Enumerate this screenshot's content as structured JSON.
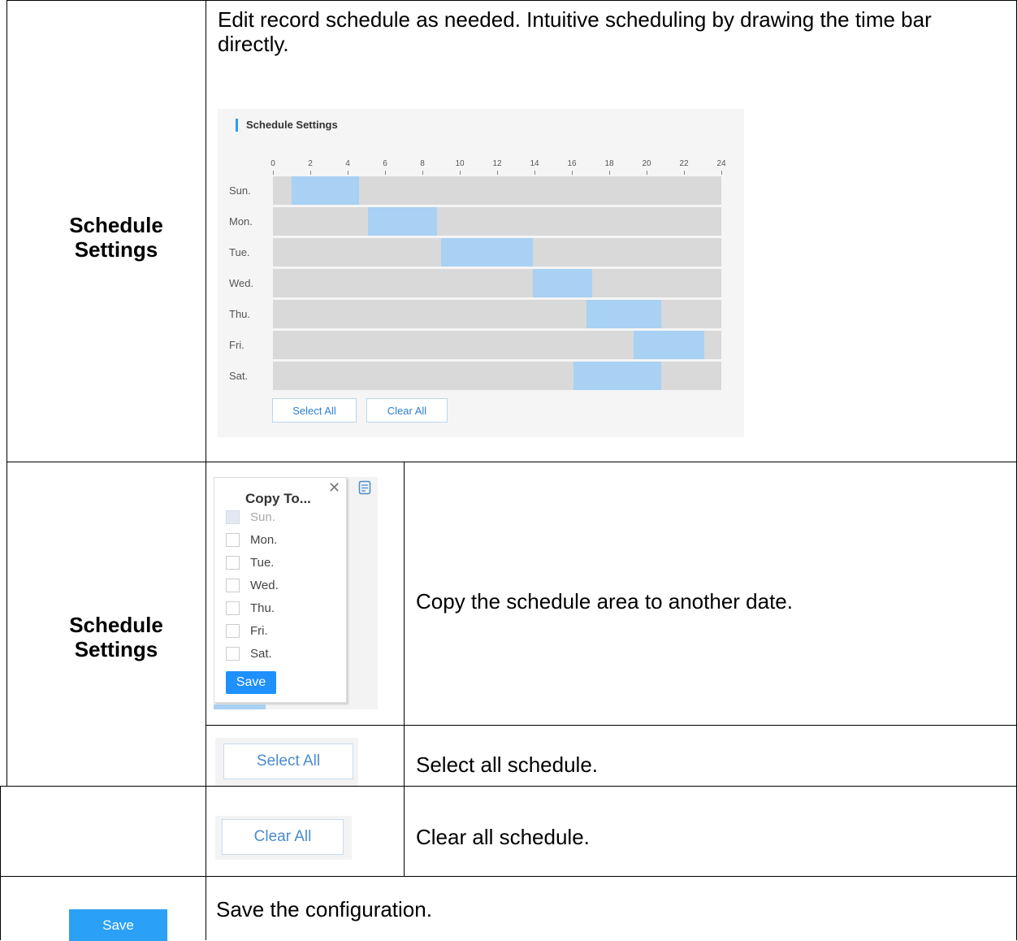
{
  "rows": {
    "r1": {
      "label": "Schedule\nSettings",
      "description": "Edit record schedule as needed. Intuitive scheduling by drawing the time bar directly."
    },
    "r2": {
      "label": "Schedule\nSettings",
      "description": "Copy the schedule area to another date."
    },
    "r3": {
      "description": "Select all schedule."
    },
    "r4": {
      "description": "Clear all schedule."
    },
    "r5": {
      "description": "Save the configuration."
    }
  },
  "schedule_panel": {
    "title": "Schedule Settings",
    "hour_ticks": [
      "0",
      "2",
      "4",
      "6",
      "8",
      "10",
      "12",
      "14",
      "16",
      "18",
      "20",
      "22",
      "24"
    ],
    "days": [
      {
        "label": "Sun.",
        "start": 1,
        "end": 4.6
      },
      {
        "label": "Mon.",
        "start": 5.1,
        "end": 8.8
      },
      {
        "label": "Tue.",
        "start": 9,
        "end": 13.9
      },
      {
        "label": "Wed.",
        "start": 13.9,
        "end": 17.1
      },
      {
        "label": "Thu.",
        "start": 16.8,
        "end": 20.8
      },
      {
        "label": "Fri.",
        "start": 19.3,
        "end": 23.1
      },
      {
        "label": "Sat.",
        "start": 16.1,
        "end": 20.8
      }
    ],
    "select_all": "Select All",
    "clear_all": "Clear All",
    "selection_color": "#a8d1f3"
  },
  "copy_popup": {
    "title": "Copy To...",
    "close_icon": "close-icon",
    "days": [
      {
        "label": "Sun.",
        "disabled": true
      },
      {
        "label": "Mon.",
        "disabled": false
      },
      {
        "label": "Tue.",
        "disabled": false
      },
      {
        "label": "Wed.",
        "disabled": false
      },
      {
        "label": "Thu.",
        "disabled": false
      },
      {
        "label": "Fri.",
        "disabled": false
      },
      {
        "label": "Sat.",
        "disabled": false
      }
    ],
    "save": "Save"
  },
  "buttons": {
    "select_all": "Select All",
    "clear_all": "Clear All",
    "save": "Save"
  },
  "colors": {
    "accent": "#1e90ff",
    "save_button": "#2aa0f7"
  }
}
